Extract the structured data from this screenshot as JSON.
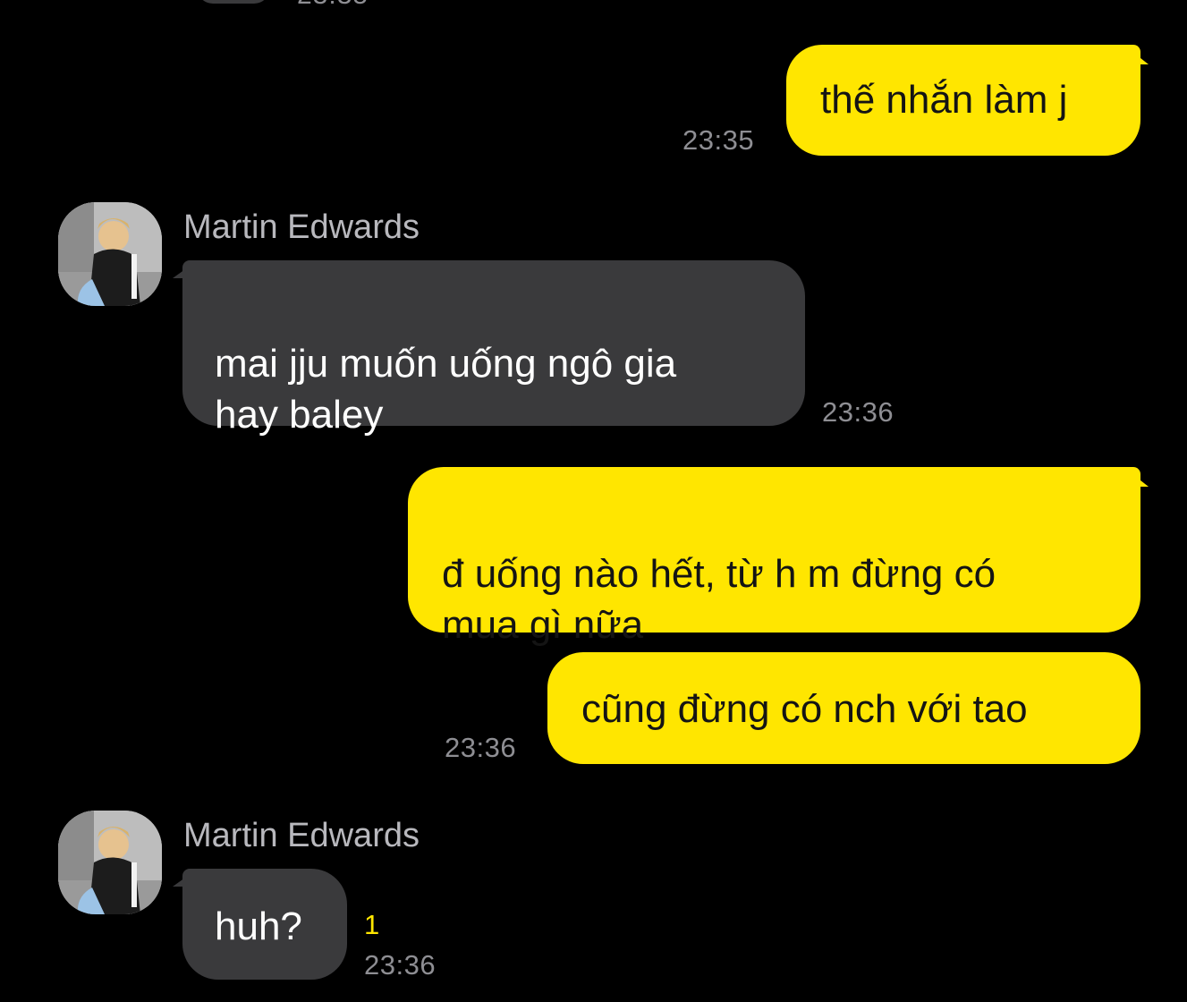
{
  "chat": {
    "messages": [
      {
        "id": "m1",
        "from": "me",
        "text": "thế nhắn làm j",
        "time": "23:35"
      },
      {
        "id": "m2",
        "from": "them",
        "sender": "Martin Edwards",
        "text": "mai jju muốn uống ngô gia\nhay baley",
        "time": "23:36"
      },
      {
        "id": "m3",
        "from": "me",
        "text": "đ uống nào hết, từ h m đừng có\nmua gì nữa",
        "time": ""
      },
      {
        "id": "m4",
        "from": "me",
        "text": "cũng đừng có nch với tao",
        "time": "23:36"
      },
      {
        "id": "m5",
        "from": "them",
        "sender": "Martin Edwards",
        "text": "huh?",
        "time": "23:36",
        "unread_count": "1"
      }
    ]
  },
  "colors": {
    "background": "#000000",
    "my_bubble": "#ffe600",
    "their_bubble": "#3a3a3c",
    "timestamp": "#8e8e93",
    "unread": "#ffe600"
  },
  "icons": {
    "avatar": "profile-photo-avatar"
  }
}
